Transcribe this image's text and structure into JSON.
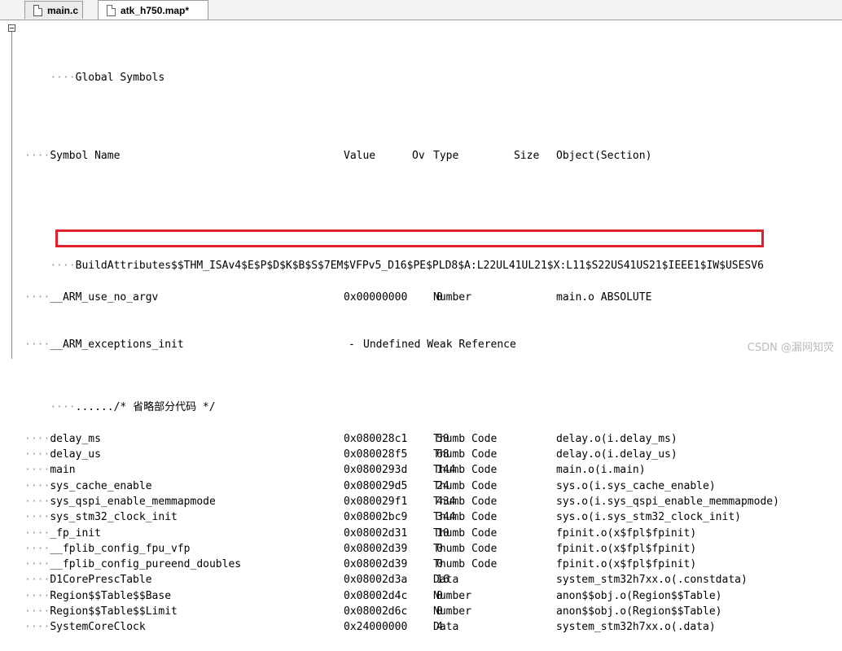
{
  "tabs": [
    {
      "label": "main.c",
      "active": false
    },
    {
      "label": "atk_h750.map*",
      "active": true
    }
  ],
  "header": {
    "section_title": "Global Symbols",
    "col_symbol": "Symbol Name",
    "col_value": "Value",
    "col_ov": "Ov",
    "col_type": "Type",
    "col_size": "Size",
    "col_object": "Object(Section)"
  },
  "build_attributes": "BuildAttributes$$THM_ISAv4$E$P$D$K$B$S$7EM$VFPv5_D16$PE$PLD8$A:L22UL41UL21$X:L11$S22US41US21$IEEE1$IW$USESV6",
  "weak_ref": {
    "name": "__ARM_exceptions_init",
    "value": "-",
    "text": "Undefined Weak Reference"
  },
  "omitted_comment": "....../* 省略部分代码 */",
  "symbols": [
    {
      "name": "__ARM_use_no_argv",
      "value": "0x00000000",
      "type": "Number",
      "size": "0",
      "object": "main.o ABSOLUTE"
    },
    {
      "name": "delay_ms",
      "value": "0x080028c1",
      "type": "Thumb Code",
      "size": "50",
      "object": "delay.o(i.delay_ms)"
    },
    {
      "name": "delay_us",
      "value": "0x080028f5",
      "type": "Thumb Code",
      "size": "68",
      "object": "delay.o(i.delay_us)"
    },
    {
      "name": "main",
      "value": "0x0800293d",
      "type": "Thumb Code",
      "size": "144",
      "object": "main.o(i.main)"
    },
    {
      "name": "sys_cache_enable",
      "value": "0x080029d5",
      "type": "Thumb Code",
      "size": "24",
      "object": "sys.o(i.sys_cache_enable)"
    },
    {
      "name": "sys_qspi_enable_memmapmode",
      "value": "0x080029f1",
      "type": "Thumb Code",
      "size": "434",
      "object": "sys.o(i.sys_qspi_enable_memmapmode)"
    },
    {
      "name": "sys_stm32_clock_init",
      "value": "0x08002bc9",
      "type": "Thumb Code",
      "size": "344",
      "object": "sys.o(i.sys_stm32_clock_init)"
    },
    {
      "name": "_fp_init",
      "value": "0x08002d31",
      "type": "Thumb Code",
      "size": "10",
      "object": "fpinit.o(x$fpl$fpinit)"
    },
    {
      "name": "__fplib_config_fpu_vfp",
      "value": "0x08002d39",
      "type": "Thumb Code",
      "size": "0",
      "object": "fpinit.o(x$fpl$fpinit)"
    },
    {
      "name": "__fplib_config_pureend_doubles",
      "value": "0x08002d39",
      "type": "Thumb Code",
      "size": "0",
      "object": "fpinit.o(x$fpl$fpinit)"
    },
    {
      "name": "D1CorePrescTable",
      "value": "0x08002d3a",
      "type": "Data",
      "size": "16",
      "object": "system_stm32h7xx.o(.constdata)"
    },
    {
      "name": "Region$$Table$$Base",
      "value": "0x08002d4c",
      "type": "Number",
      "size": "0",
      "object": "anon$$obj.o(Region$$Table)"
    },
    {
      "name": "Region$$Table$$Limit",
      "value": "0x08002d6c",
      "type": "Number",
      "size": "0",
      "object": "anon$$obj.o(Region$$Table)"
    },
    {
      "name": "SystemCoreClock",
      "value": "0x24000000",
      "type": "Data",
      "size": "4",
      "object": "system_stm32h7xx.o(.data)"
    }
  ],
  "watermark": "CSDN @漏网知荧"
}
